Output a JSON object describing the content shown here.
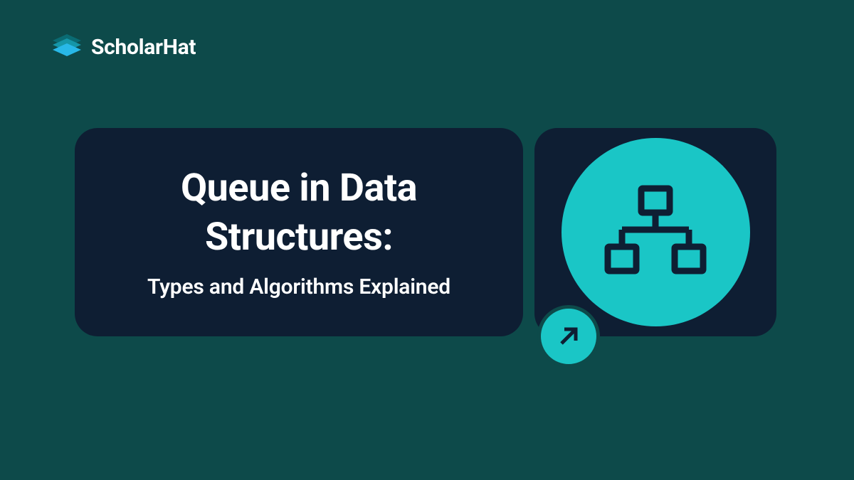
{
  "brand": {
    "name": "ScholarHat"
  },
  "content": {
    "title": "Queue in Data Structures:",
    "subtitle": "Types and Algorithms Explained"
  },
  "colors": {
    "background": "#0d4a4a",
    "cardBackground": "#0e1e33",
    "accent": "#1ac6c6",
    "text": "#ffffff"
  },
  "icons": {
    "logo": "layers-icon",
    "main": "tree-structure-icon",
    "badge": "arrow-up-right-icon"
  }
}
